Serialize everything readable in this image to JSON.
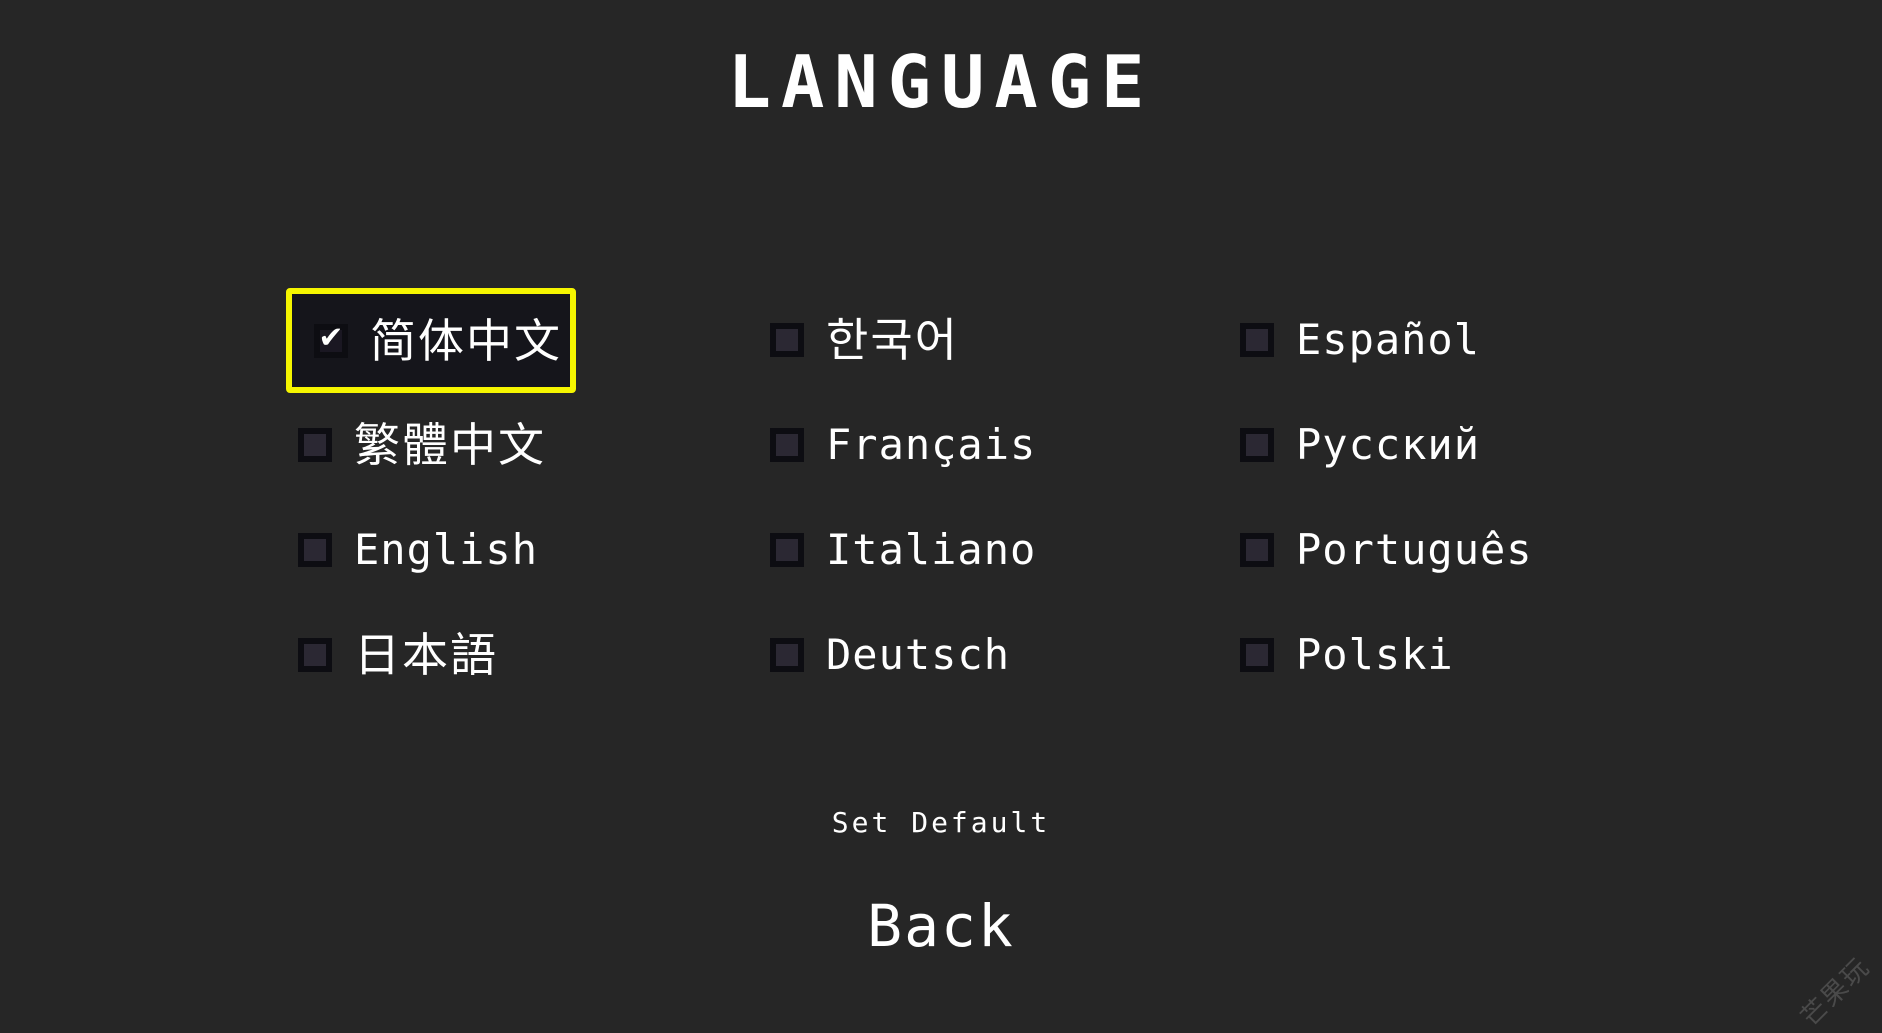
{
  "screen": {
    "title": "LANGUAGE",
    "background_color": "#262626",
    "text_color": "#ffffff",
    "highlight_color": "#f5f500",
    "highlight_fill_color": "#15151b",
    "checkbox_color": "#0d0d12",
    "checkbox_inner_color": "#2b2833"
  },
  "languages": [
    {
      "label": "简体中文",
      "checked": true,
      "selected": true,
      "column": 1,
      "row": 1,
      "script": "cjk",
      "checkmark": "✔"
    },
    {
      "label": "繁體中文",
      "checked": false,
      "selected": false,
      "column": 1,
      "row": 2,
      "script": "cjk",
      "checkmark": ""
    },
    {
      "label": "English",
      "checked": false,
      "selected": false,
      "column": 1,
      "row": 3,
      "script": "latin",
      "checkmark": ""
    },
    {
      "label": "日本語",
      "checked": false,
      "selected": false,
      "column": 1,
      "row": 4,
      "script": "cjk",
      "checkmark": ""
    },
    {
      "label": "한국어",
      "checked": false,
      "selected": false,
      "column": 2,
      "row": 1,
      "script": "cjk",
      "checkmark": ""
    },
    {
      "label": "Français",
      "checked": false,
      "selected": false,
      "column": 2,
      "row": 2,
      "script": "latin",
      "checkmark": ""
    },
    {
      "label": "Italiano",
      "checked": false,
      "selected": false,
      "column": 2,
      "row": 3,
      "script": "latin",
      "checkmark": ""
    },
    {
      "label": "Deutsch",
      "checked": false,
      "selected": false,
      "column": 2,
      "row": 4,
      "script": "latin",
      "checkmark": ""
    },
    {
      "label": "Español",
      "checked": false,
      "selected": false,
      "column": 3,
      "row": 1,
      "script": "latin",
      "checkmark": ""
    },
    {
      "label": "Русский",
      "checked": false,
      "selected": false,
      "column": 3,
      "row": 2,
      "script": "latin",
      "checkmark": ""
    },
    {
      "label": "Português",
      "checked": false,
      "selected": false,
      "column": 3,
      "row": 3,
      "script": "latin",
      "checkmark": ""
    },
    {
      "label": "Polski",
      "checked": false,
      "selected": false,
      "column": 3,
      "row": 4,
      "script": "latin",
      "checkmark": ""
    }
  ],
  "footer": {
    "set_default_label": "Set Default",
    "back_label": "Back"
  },
  "watermark": {
    "text": "芒果玩"
  }
}
